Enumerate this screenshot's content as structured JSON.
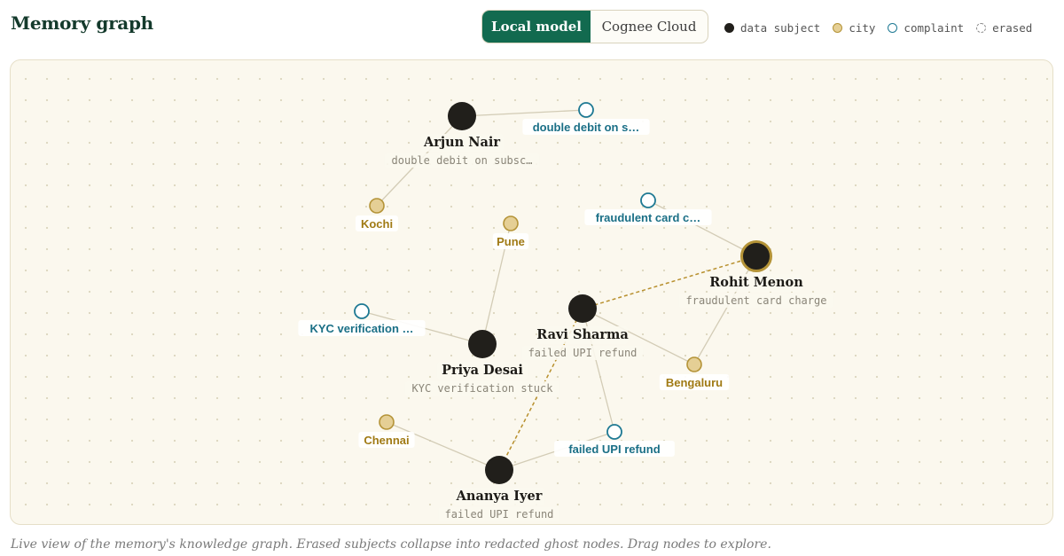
{
  "header": {
    "title": "Memory graph",
    "toggle": {
      "local_label": "Local model",
      "cloud_label": "Cognee Cloud",
      "selected": "local"
    }
  },
  "legend": [
    {
      "type": "subject",
      "label": "data subject"
    },
    {
      "type": "city",
      "label": "city"
    },
    {
      "type": "complaint",
      "label": "complaint"
    },
    {
      "type": "erased",
      "label": "erased"
    }
  ],
  "colors": {
    "subject": "#211f1b",
    "city_fill": "#e5cf95",
    "city_stroke": "#b49337",
    "city_text": "#a07a14",
    "complaint_stroke": "#1e7993",
    "complaint_text": "#1a6f86",
    "edge": "#d3ccb6",
    "dashed_edge": "#b8902e",
    "accent": "#126a4f"
  },
  "graph": {
    "nodes": [
      {
        "id": "arjun",
        "type": "subject",
        "label": "Arjun Nair",
        "sub": "double debit on subsc…"
      },
      {
        "id": "rohit",
        "type": "subject",
        "label": "Rohit Menon",
        "sub": "fraudulent card charge",
        "highlight": true
      },
      {
        "id": "ravi",
        "type": "subject",
        "label": "Ravi Sharma",
        "sub": "failed UPI refund"
      },
      {
        "id": "priya",
        "type": "subject",
        "label": "Priya Desai",
        "sub": "KYC verification stuck"
      },
      {
        "id": "ananya",
        "type": "subject",
        "label": "Ananya Iyer",
        "sub": "failed UPI refund"
      },
      {
        "id": "c_double",
        "type": "complaint",
        "label": "double debit on s…"
      },
      {
        "id": "c_fraud",
        "type": "complaint",
        "label": "fraudulent card c…"
      },
      {
        "id": "c_kyc",
        "type": "complaint",
        "label": "KYC verification …"
      },
      {
        "id": "c_upi",
        "type": "complaint",
        "label": "failed UPI refund"
      },
      {
        "id": "kochi",
        "type": "city",
        "label": "Kochi"
      },
      {
        "id": "pune",
        "type": "city",
        "label": "Pune"
      },
      {
        "id": "bengaluru",
        "type": "city",
        "label": "Bengaluru"
      },
      {
        "id": "chennai",
        "type": "city",
        "label": "Chennai"
      }
    ],
    "edges": [
      {
        "from": "arjun",
        "to": "c_double"
      },
      {
        "from": "arjun",
        "to": "kochi"
      },
      {
        "from": "rohit",
        "to": "c_fraud"
      },
      {
        "from": "rohit",
        "to": "bengaluru"
      },
      {
        "from": "ravi",
        "to": "rohit",
        "dashed": true
      },
      {
        "from": "ravi",
        "to": "bengaluru"
      },
      {
        "from": "ravi",
        "to": "c_upi"
      },
      {
        "from": "ravi",
        "to": "ananya",
        "dashed": true
      },
      {
        "from": "priya",
        "to": "c_kyc"
      },
      {
        "from": "priya",
        "to": "pune"
      },
      {
        "from": "ananya",
        "to": "chennai"
      },
      {
        "from": "ananya",
        "to": "c_upi"
      }
    ]
  },
  "caption": "Live view of the memory's knowledge graph. Erased subjects collapse into redacted ghost nodes. Drag nodes to explore."
}
